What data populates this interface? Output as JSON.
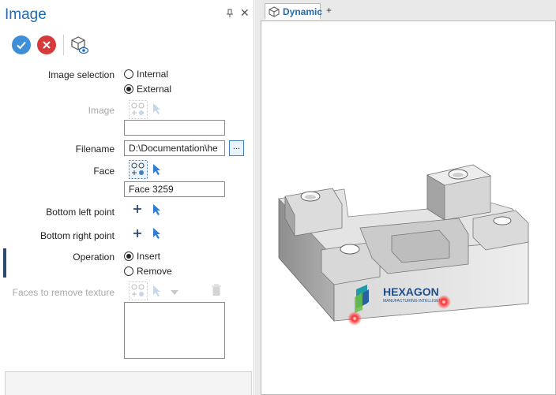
{
  "panel": {
    "title": "Image",
    "pin_glyph": "ᵽ",
    "close_glyph": "✕"
  },
  "toolbar": {
    "ok_icon": "check-icon",
    "cancel_icon": "x-icon",
    "view_icon": "cube-eye-icon",
    "colors": {
      "ok": "#3f8fd8",
      "cancel": "#d63a3a"
    }
  },
  "form": {
    "image_selection": {
      "label": "Image selection",
      "options": [
        {
          "label": "Internal",
          "selected": false
        },
        {
          "label": "External",
          "selected": true
        }
      ]
    },
    "image": {
      "label": "Image",
      "value": ""
    },
    "filename": {
      "label": "Filename",
      "value": "D:\\Documentation\\he",
      "browse_label": "..."
    },
    "face": {
      "label": "Face",
      "value": "Face 3259"
    },
    "bottom_left_point": {
      "label": "Bottom left point"
    },
    "bottom_right_point": {
      "label": "Bottom right point"
    },
    "operation": {
      "label": "Operation",
      "options": [
        {
          "label": "Insert",
          "selected": true
        },
        {
          "label": "Remove",
          "selected": false
        }
      ]
    },
    "faces_to_remove": {
      "label": "Faces to remove texture"
    }
  },
  "viewport": {
    "tab_label": "Dynamic",
    "add_tab_label": "+",
    "model": {
      "brand_text": "HEXAGON",
      "brand_subtext": "MANUFACTURING INTELLIGENCE",
      "marker_color": "#ff2020"
    }
  }
}
